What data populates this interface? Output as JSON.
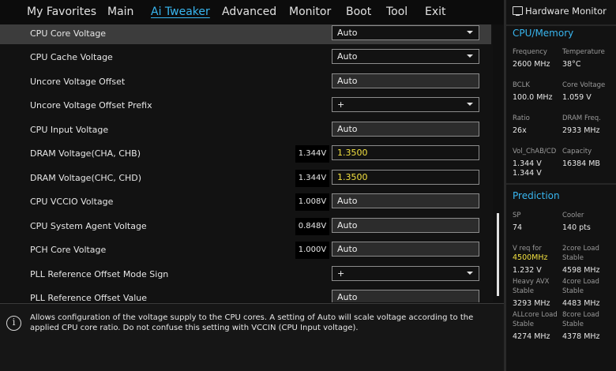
{
  "nav": {
    "tabs": [
      "My Favorites",
      "Main",
      "Ai Tweaker",
      "Advanced",
      "Monitor",
      "Boot",
      "Tool",
      "Exit"
    ],
    "active": "Ai Tweaker"
  },
  "settings": [
    {
      "label": "CPU Core Voltage",
      "current": "",
      "value": "Auto",
      "type": "dropdown",
      "selected": true
    },
    {
      "label": "CPU Cache Voltage",
      "current": "",
      "value": "Auto",
      "type": "dropdown"
    },
    {
      "label": "Uncore Voltage Offset",
      "current": "",
      "value": "Auto",
      "type": "input"
    },
    {
      "label": "Uncore Voltage Offset Prefix",
      "current": "",
      "value": "+",
      "type": "dropdown"
    },
    {
      "label": "CPU Input Voltage",
      "current": "",
      "value": "Auto",
      "type": "input"
    },
    {
      "label": "DRAM Voltage(CHA, CHB)",
      "current": "1.344V",
      "value": "1.3500",
      "type": "input-yellow"
    },
    {
      "label": "DRAM Voltage(CHC, CHD)",
      "current": "1.344V",
      "value": "1.3500",
      "type": "input-yellow"
    },
    {
      "label": "CPU VCCIO Voltage",
      "current": "1.008V",
      "value": "Auto",
      "type": "input"
    },
    {
      "label": "CPU System Agent Voltage",
      "current": "0.848V",
      "value": "Auto",
      "type": "input"
    },
    {
      "label": "PCH Core Voltage",
      "current": "1.000V",
      "value": "Auto",
      "type": "input"
    },
    {
      "label": "PLL Reference Offset Mode Sign",
      "current": "",
      "value": "+",
      "type": "dropdown"
    },
    {
      "label": "PLL Reference Offset Value",
      "current": "",
      "value": "Auto",
      "type": "input"
    }
  ],
  "help": {
    "text": "Allows configuration of the voltage supply to the CPU cores. A setting of Auto will scale voltage according to the applied CPU core ratio.  Do not confuse this setting with VCCIN (CPU Input voltage)."
  },
  "hardware_monitor": {
    "title": "Hardware Monitor",
    "cpu_memory": {
      "heading": "CPU/Memory",
      "frequency_label": "Frequency",
      "frequency": "2600 MHz",
      "temperature_label": "Temperature",
      "temperature": "38°C",
      "bclk_label": "BCLK",
      "bclk": "100.0 MHz",
      "core_voltage_label": "Core Voltage",
      "core_voltage": "1.059 V",
      "ratio_label": "Ratio",
      "ratio": "26x",
      "dram_freq_label": "DRAM Freq.",
      "dram_freq": "2933 MHz",
      "vol_label": "Vol_ChAB/CD",
      "vol_ab": "1.344 V",
      "vol_cd": "1.344 V",
      "capacity_label": "Capacity",
      "capacity": "16384 MB"
    },
    "prediction": {
      "heading": "Prediction",
      "sp_label": "SP",
      "sp": "74",
      "cooler_label": "Cooler",
      "cooler": "140 pts",
      "vreq_label": "V req for",
      "vreq_freq": "4500MHz",
      "vreq": "1.232 V",
      "twocore_label_1": "2core Load",
      "twocore_label_2": "Stable",
      "twocore": "4598 MHz",
      "heavyavx_label_1": "Heavy AVX",
      "heavyavx_label_2": "Stable",
      "heavyavx": "3293 MHz",
      "fourcore_label_1": "4core Load",
      "fourcore_label_2": "Stable",
      "fourcore": "4483 MHz",
      "allcore_label_1": "ALLcore Load",
      "allcore_label_2": "Stable",
      "allcore": "4274 MHz",
      "eightcore_label_1": "8core Load",
      "eightcore_label_2": "Stable",
      "eightcore": "4378 MHz"
    }
  }
}
